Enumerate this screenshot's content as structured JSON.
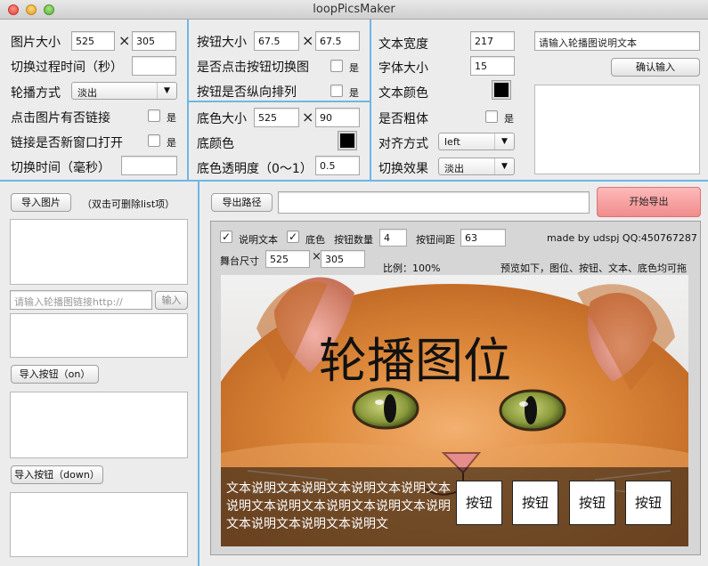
{
  "window": {
    "title": "loopPicsMaker"
  },
  "settings_left": {
    "pic_size_label": "图片大小",
    "pic_width": "525",
    "pic_height": "305",
    "transition_time_label": "切换过程时间（秒）",
    "transition_time": "",
    "loop_mode_label": "轮播方式",
    "loop_mode": "淡出",
    "click_link_label": "点击图片有否链接",
    "click_link_checkbox_label": "是",
    "new_window_label": "链接是否新窗口打开",
    "new_window_checkbox_label": "是",
    "switch_time_label": "切换时间（毫秒）",
    "switch_time": ""
  },
  "settings_middle": {
    "button_size_label": "按钮大小",
    "button_width": "67.5",
    "button_height": "67.5",
    "click_switch_label": "是否点击按钮切换图",
    "click_switch_checkbox_label": "是",
    "vertical_label": "按钮是否纵向排列",
    "vertical_checkbox_label": "是",
    "bg_size_label": "底色大小",
    "bg_width": "525",
    "bg_height": "90",
    "bg_color_label": "底颜色",
    "bg_color": "#000000",
    "bg_opacity_label": "底色透明度（0〜1）",
    "bg_opacity": "0.5"
  },
  "settings_right": {
    "text_width_label": "文本宽度",
    "text_width": "217",
    "font_size_label": "字体大小",
    "font_size": "15",
    "text_color_label": "文本颜色",
    "text_color": "#000000",
    "bold_label": "是否粗体",
    "bold_checkbox_label": "是",
    "align_label": "对齐方式",
    "align": "left",
    "effect_label": "切换效果",
    "effect": "淡出",
    "caption_placeholder": "请输入轮播图说明文本",
    "confirm_label": "确认输入"
  },
  "left_panel": {
    "import_pics_label": "导入图片",
    "import_hint": "（双击可删除list项）",
    "link_placeholder": "请输入轮播图链接http://",
    "link_input_label": "输入",
    "import_on_label": "导入按钮（on）",
    "import_down_label": "导入按钮（down）"
  },
  "export": {
    "path_label": "导出路径",
    "path_value": "",
    "start_label": "开始导出"
  },
  "preview": {
    "caption_text_label": "说明文本",
    "caption_text_checked": true,
    "bg_label": "底色",
    "bg_checked": true,
    "button_count_label": "按钮数量",
    "button_count": "4",
    "button_gap_label": "按钮间距",
    "button_gap": "63",
    "credit": "made by udspj QQ:450767287",
    "stage_size_label": "舞台尺寸",
    "stage_width": "525",
    "stage_height": "305",
    "ratio": "比例：100%",
    "hint": "预览如下，图位、按钮、文本、底色均可拖",
    "stage_title": "轮播图位",
    "caption": "文本说明文本说明文本说明文本说明文本说明文本说明文本说明文本说明文本说明文本说明文本说明文本说明文",
    "stage_buttons": [
      "按钮",
      "按钮",
      "按钮",
      "按钮"
    ]
  },
  "colors": {
    "divider": "#6fb6e6",
    "export_button": "#f08c8c",
    "caption_bg": "rgba(0,0,0,0.5)"
  },
  "icons": {
    "times": "×",
    "dropdown": "▼",
    "check": "✓"
  }
}
